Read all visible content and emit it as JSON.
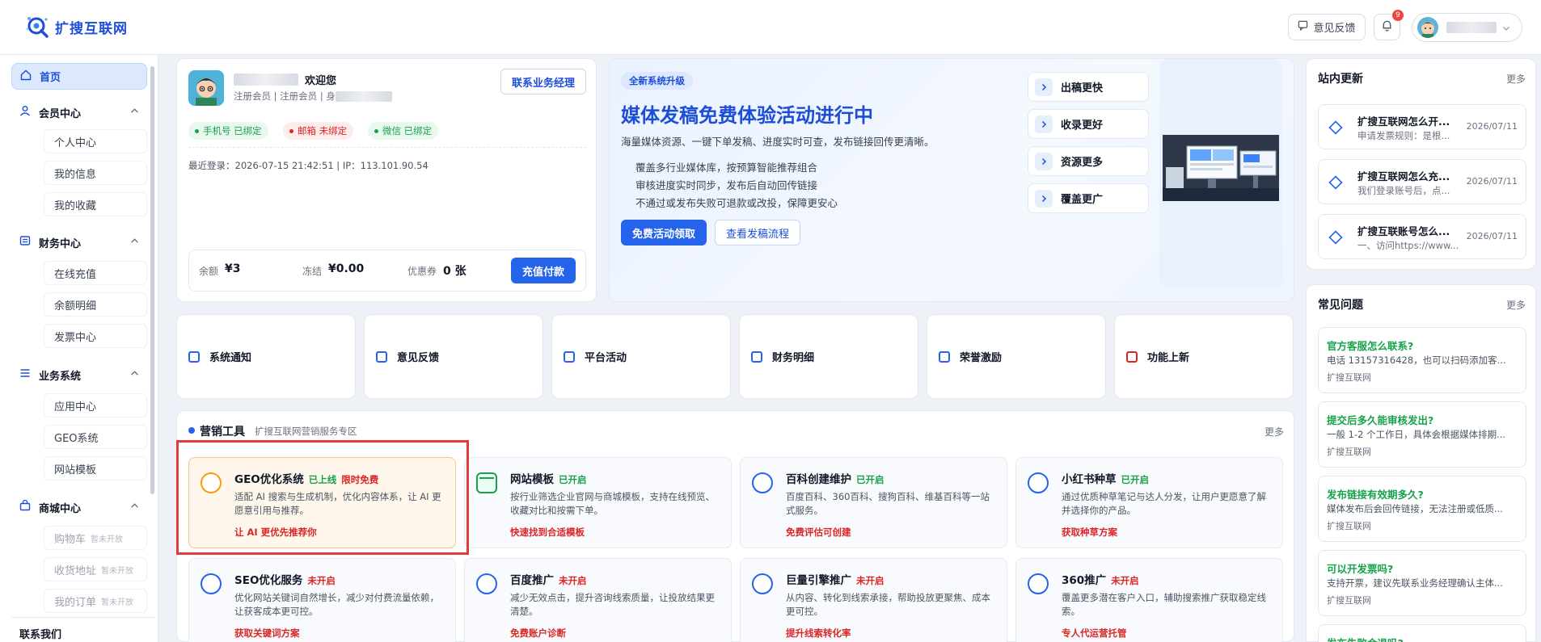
{
  "header": {
    "logo_text": "扩搜互联网",
    "feedback_label": "意见反馈",
    "notification_count": "9"
  },
  "sidebar": {
    "home": "首页",
    "groups": [
      {
        "label": "会员中心",
        "items": [
          "个人中心",
          "我的信息",
          "我的收藏"
        ]
      },
      {
        "label": "财务中心",
        "items": [
          "在线充值",
          "余额明细",
          "发票中心"
        ]
      },
      {
        "label": "业务系统",
        "items": [
          "应用中心",
          "GEO系统",
          "网站模板"
        ]
      },
      {
        "label": "商城中心",
        "items": [
          "购物车",
          "收货地址",
          "我的订单"
        ],
        "tag": "暂未开放"
      }
    ],
    "contact": "联系我们"
  },
  "profile": {
    "welcome": "欢迎您",
    "meta": "注册会员 | 注册会员 | 身",
    "contact_manager": "联系业务经理",
    "pills": [
      {
        "text": "手机号 已绑定",
        "color": "#16a34a",
        "bg": "#e9f8ef"
      },
      {
        "text": "邮箱 未绑定",
        "color": "#dc2626",
        "bg": "#fdecec"
      },
      {
        "text": "微信 已绑定",
        "color": "#16a34a",
        "bg": "#e9f8ef"
      }
    ],
    "last_login": "最近登录：2026-07-15 21:42:51 | IP：113.101.90.54",
    "balance_label": "余额",
    "balance_value": "¥3",
    "frozen_label": "冻结",
    "frozen_value": "¥0.00",
    "coupon_label": "优惠券",
    "coupon_value": "0 张",
    "recharge_button": "充值付款"
  },
  "promo": {
    "badge": "全新系统升级",
    "title": "媒体发稿免费体验活动进行中",
    "subtitle": "海量媒体资源、一键下单发稿、进度实时可查，发布链接回传更清晰。",
    "bullets": [
      "覆盖多行业媒体库，按预算智能推荐组合",
      "审核进度实时同步，发布后自动回传链接",
      "不通过或发布失败可退款或改投，保障更安心"
    ],
    "primary_button": "免费活动领取",
    "secondary_button": "查看发稿流程",
    "features": [
      "出稿更快",
      "收录更好",
      "资源更多",
      "覆盖更广"
    ]
  },
  "quick_tiles": [
    {
      "label": "系统通知",
      "color": "#2563eb"
    },
    {
      "label": "意见反馈",
      "color": "#2563eb"
    },
    {
      "label": "平台活动",
      "color": "#2563eb"
    },
    {
      "label": "财务明细",
      "color": "#2563eb"
    },
    {
      "label": "荣誉激励",
      "color": "#2563eb"
    },
    {
      "label": "功能上新",
      "color": "#dc2626"
    }
  ],
  "marketing": {
    "title": "营销工具",
    "subtitle": "扩搜互联网营销服务专区",
    "more": "更多",
    "tools": [
      {
        "name": "GEO优化系统",
        "status": "已上线",
        "status_color": "#16a34a",
        "extra": "限时免费",
        "desc": "适配 AI 搜索与生成机制，优化内容体系，让 AI 更愿意引用与推荐。",
        "link": "让 AI 更优先推荐你",
        "icon": "circle-icon"
      },
      {
        "name": "网站模板",
        "status": "已开启",
        "status_color": "#16a34a",
        "extra": "",
        "desc": "按行业筛选企业官网与商城模板，支持在线预览、收藏对比和按需下单。",
        "link": "快速找到合适模板",
        "icon": "browser-icon"
      },
      {
        "name": "百科创建维护",
        "status": "已开启",
        "status_color": "#16a34a",
        "extra": "",
        "desc": "百度百科、360百科、搜狗百科、维基百科等一站式服务。",
        "link": "免费评估可创建",
        "icon": "circle-icon"
      },
      {
        "name": "小红书种草",
        "status": "已开启",
        "status_color": "#16a34a",
        "extra": "",
        "desc": "通过优质种草笔记与达人分发，让用户更愿意了解并选择你的产品。",
        "link": "获取种草方案",
        "icon": "circle-icon"
      },
      {
        "name": "SEO优化服务",
        "status": "未开启",
        "status_color": "#dc2626",
        "extra": "",
        "desc": "优化网站关键词自然增长，减少对付费流量依赖，让获客成本更可控。",
        "link": "获取关键词方案",
        "icon": "circle-icon"
      },
      {
        "name": "百度推广",
        "status": "未开启",
        "status_color": "#dc2626",
        "extra": "",
        "desc": "减少无效点击，提升咨询线索质量，让投放结果更清楚。",
        "link": "免费账户诊断",
        "icon": "circle-icon"
      },
      {
        "name": "巨量引擎推广",
        "status": "未开启",
        "status_color": "#dc2626",
        "extra": "",
        "desc": "从内容、转化到线索承接，帮助投放更聚焦、成本更可控。",
        "link": "提升线索转化率",
        "icon": "circle-icon"
      },
      {
        "name": "360推广",
        "status": "未开启",
        "status_color": "#dc2626",
        "extra": "",
        "desc": "覆盖更多潜在客户入口，辅助搜索推广获取稳定线索。",
        "link": "专人代运营托管",
        "icon": "circle-icon"
      }
    ]
  },
  "updates": {
    "title": "站内更新",
    "more": "更多",
    "items": [
      {
        "title": "扩搜互联网怎么开...",
        "summary": "申请发票规则：是根...",
        "date": "2026/07/11"
      },
      {
        "title": "扩搜互联网怎么充...",
        "summary": "我们登录账号后，点...",
        "date": "2026/07/11"
      },
      {
        "title": "扩搜互联账号怎么...",
        "summary": "一、访问https://www...",
        "date": "2026/07/11"
      }
    ]
  },
  "faq": {
    "title": "常见问题",
    "more": "更多",
    "items": [
      {
        "q": "官方客服怎么联系?",
        "a": "电话 13157316428，也可以扫码添加客...",
        "src": "扩搜互联网"
      },
      {
        "q": "提交后多久能审核发出?",
        "a": "一般 1-2 个工作日，具体会根据媒体排期...",
        "src": "扩搜互联网"
      },
      {
        "q": "发布链接有效期多久?",
        "a": "媒体发布后会回传链接，无法注册或低质...",
        "src": "扩搜互联网"
      },
      {
        "q": "可以开发票吗?",
        "a": "支持开票，建议先联系业务经理确认主体...",
        "src": "扩搜互联网"
      },
      {
        "q": "发布失败会退吗?",
        "a": "",
        "src": ""
      }
    ]
  }
}
